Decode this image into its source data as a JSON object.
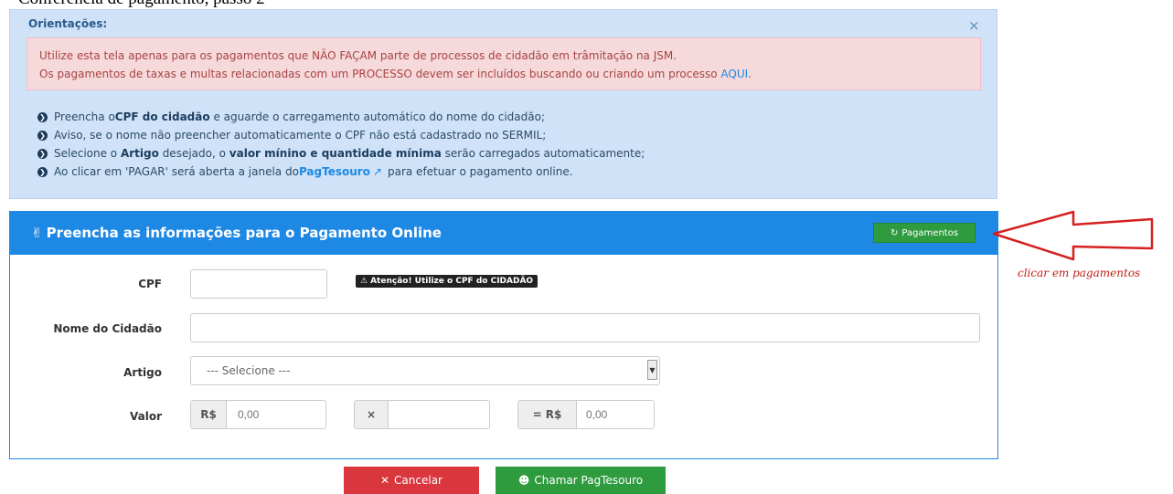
{
  "doc_title": "Conferência de pagamento, passo 2",
  "orientacoes": {
    "title": "Orientações:",
    "close_icon": "close-icon",
    "alert": {
      "line1": "Utilize esta tela apenas para os pagamentos que NÃO FAÇAM parte de processos de cidadão em trâmitação na JSM.",
      "line2_before": "Os pagamentos de taxas e multas relacionadas com um PROCESSO devem ser incluídos buscando ou criando um processo ",
      "line2_link": "AQUI",
      "line2_after": "."
    },
    "bullets": [
      {
        "a": "Preencha o ",
        "b": "CPF do cidadão",
        "c": " e aguarde o carregamento automático do nome do cidadão;"
      },
      {
        "a": "Aviso, se o nome não preencher automaticamente o CPF não está cadastrado no SERMIL;"
      },
      {
        "a": "Selecione o ",
        "b": "Artigo",
        "c": " desejado, o ",
        "d": "valor mínino e quantidade mínima",
        "e": " serão carregados automaticamente;"
      },
      {
        "a": "Ao clicar em 'PAGAR' será aberta a janela do ",
        "link": "PagTesouro",
        "e": " para efetuar o pagamento online."
      }
    ]
  },
  "form": {
    "header_title": "Preencha as informações para o Pagamento Online",
    "pagamentos_button": "Pagamentos",
    "cpf_label": "CPF",
    "cpf_warning": "Atenção! Utilize o CPF do CIDADÃO",
    "nome_label": "Nome do Cidadão",
    "artigo_label": "Artigo",
    "artigo_selected": "--- Selecione ---",
    "valor_label": "Valor",
    "currency_prefix": "R$",
    "valor_placeholder": "0,00",
    "times_symbol": "×",
    "equals_prefix": "= R$",
    "total_placeholder": "0,00",
    "cancel_button": "Cancelar",
    "call_button": "Chamar PagTesouro"
  },
  "annotation": {
    "text": "clicar em pagamentos",
    "color": "#c0201a"
  },
  "colors": {
    "primary": "#1e88e5",
    "success": "#2e9b3e",
    "danger": "#d9363e",
    "info_bg": "#cfe2f7",
    "alert_bg": "#f5d9db"
  }
}
